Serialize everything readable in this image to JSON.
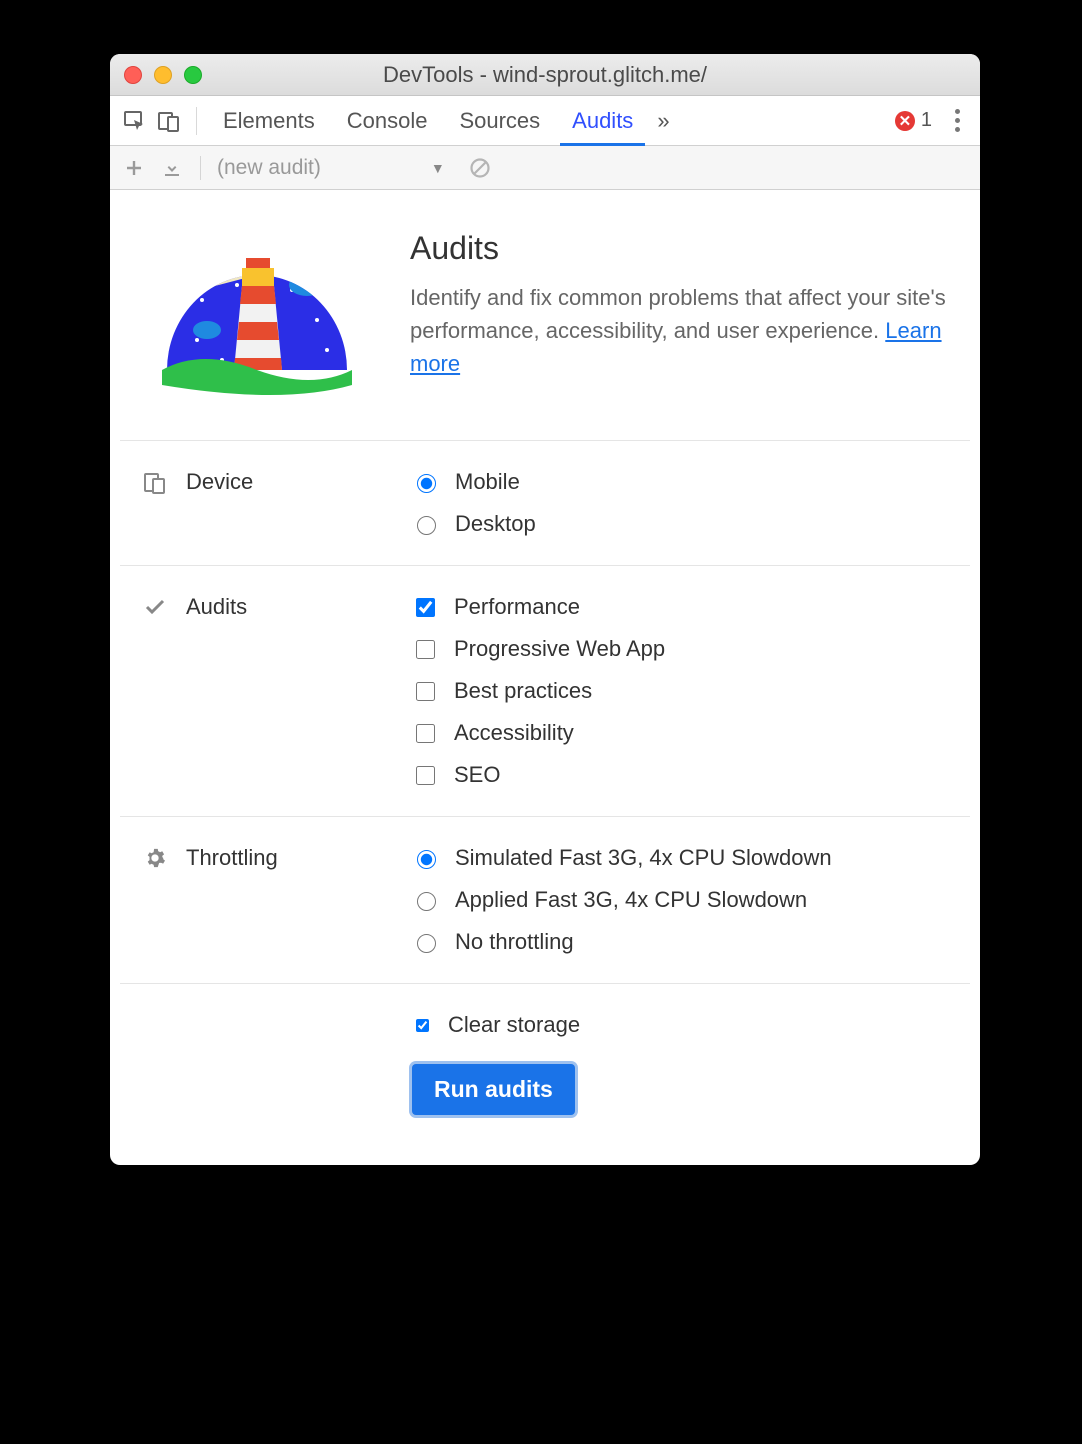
{
  "window": {
    "title": "DevTools - wind-sprout.glitch.me/"
  },
  "tabs": {
    "items": [
      "Elements",
      "Console",
      "Sources",
      "Audits"
    ],
    "active": "Audits",
    "overflow_glyph": "»",
    "errors": "1"
  },
  "toolbar": {
    "audit_select": "(new audit)"
  },
  "header": {
    "title": "Audits",
    "description": "Identify and fix common problems that affect your site's performance, accessibility, and user experience. ",
    "learn_more": "Learn more"
  },
  "sections": {
    "device": {
      "label": "Device",
      "options": [
        {
          "label": "Mobile",
          "checked": true
        },
        {
          "label": "Desktop",
          "checked": false
        }
      ]
    },
    "audits": {
      "label": "Audits",
      "options": [
        {
          "label": "Performance",
          "checked": true
        },
        {
          "label": "Progressive Web App",
          "checked": false
        },
        {
          "label": "Best practices",
          "checked": false
        },
        {
          "label": "Accessibility",
          "checked": false
        },
        {
          "label": "SEO",
          "checked": false
        }
      ]
    },
    "throttling": {
      "label": "Throttling",
      "options": [
        {
          "label": "Simulated Fast 3G, 4x CPU Slowdown",
          "checked": true
        },
        {
          "label": "Applied Fast 3G, 4x CPU Slowdown",
          "checked": false
        },
        {
          "label": "No throttling",
          "checked": false
        }
      ]
    }
  },
  "clear_storage": {
    "label": "Clear storage",
    "checked": true
  },
  "run_button": "Run audits"
}
